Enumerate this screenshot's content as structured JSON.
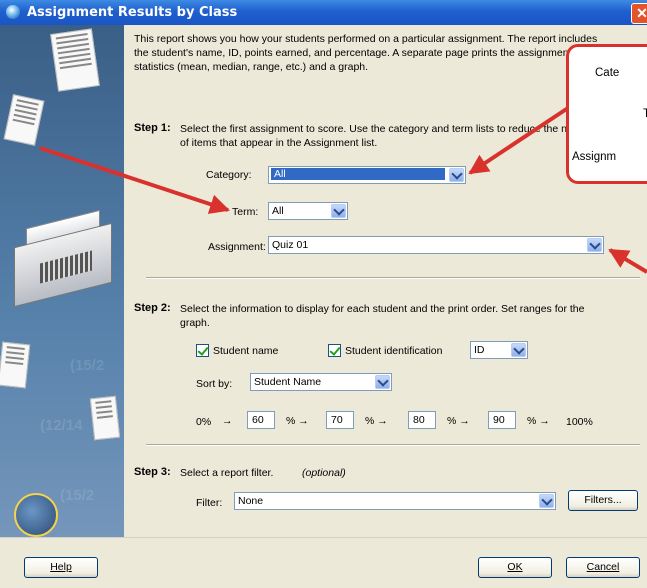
{
  "window": {
    "title": "Assignment Results by Class",
    "close_glyph": "✕"
  },
  "description": "This report shows you how your students performed on a particular assignment. The report includes the student's name, ID, points earned, and percentage. A separate page prints the assignment statistics (mean, median, range, etc.) and a graph.",
  "step1": {
    "label": "Step 1:",
    "text": "Select the first assignment to score. Use the category and term lists to reduce the number of items that appear in the Assignment list.",
    "category_label": "Category:",
    "category_value": "All",
    "term_label": "Term:",
    "term_value": "All",
    "assignment_label": "Assignment:",
    "assignment_value": "Quiz 01"
  },
  "step2": {
    "label": "Step 2:",
    "text": "Select the information to display for each student and the print order. Set ranges for the graph.",
    "student_name_label": "Student name",
    "student_name_checked": true,
    "student_id_label": "Student identification",
    "student_id_checked": true,
    "id_value": "ID",
    "sort_label": "Sort by:",
    "sort_value": "Student Name",
    "range_start": "0%",
    "range_values": [
      "60",
      "70",
      "80",
      "90"
    ],
    "pct_arrow": "% →",
    "arrow": "→",
    "range_end": "100%"
  },
  "step3": {
    "label": "Step 3:",
    "text": "Select a report filter.",
    "optional": "(optional)",
    "filter_label": "Filter:",
    "filter_value": "None",
    "filters_button": "Filters..."
  },
  "buttons": {
    "help": "Help",
    "ok": "OK",
    "cancel": "Cancel"
  },
  "callout": {
    "line1": "Cate",
    "line2": "T",
    "line3": "Assignm"
  },
  "annotation_color": "#d9322d",
  "sidebar_faint": [
    "(15/2",
    "(12/14",
    "(15/2"
  ]
}
